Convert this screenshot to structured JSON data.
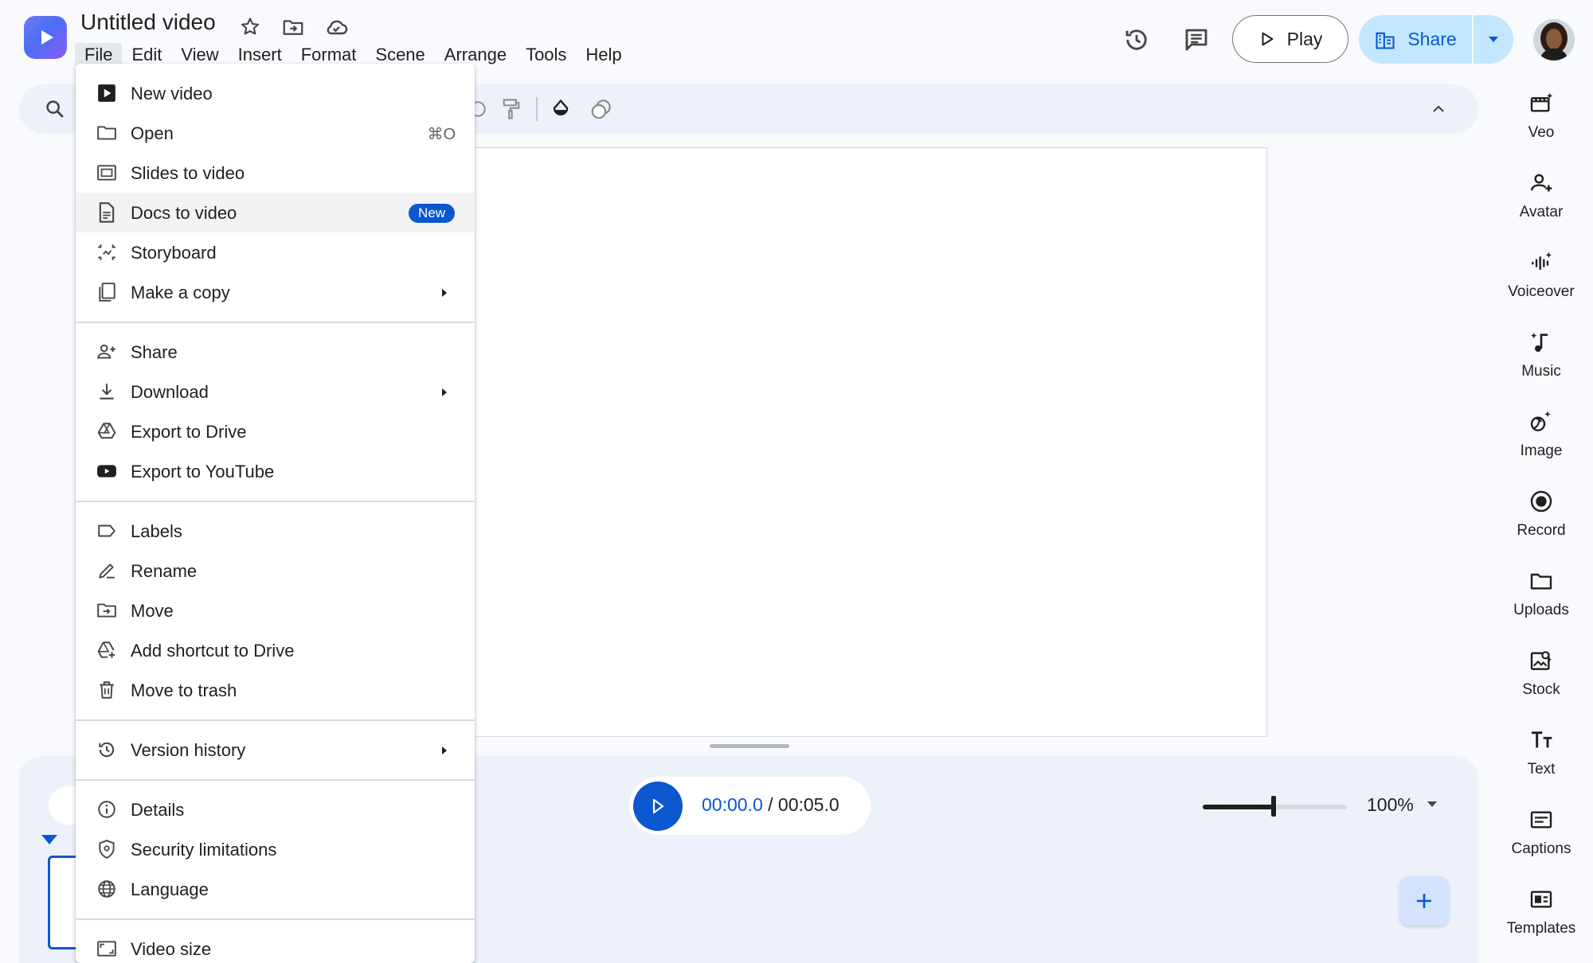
{
  "header": {
    "title": "Untitled video",
    "menus": [
      "File",
      "Edit",
      "View",
      "Insert",
      "Format",
      "Scene",
      "Arrange",
      "Tools",
      "Help"
    ],
    "play_label": "Play",
    "share_label": "Share"
  },
  "playback": {
    "current": "00:00.0",
    "separator": " / ",
    "total": "00:05.0",
    "zoom": "100%",
    "zoom_level": 0.49
  },
  "rail": [
    {
      "label": "Veo",
      "icon": "veo-icon"
    },
    {
      "label": "Avatar",
      "icon": "avatar-icon"
    },
    {
      "label": "Voiceover",
      "icon": "voiceover-icon"
    },
    {
      "label": "Music",
      "icon": "music-icon"
    },
    {
      "label": "Image",
      "icon": "image-icon"
    },
    {
      "label": "Record",
      "icon": "record-icon"
    },
    {
      "label": "Uploads",
      "icon": "uploads-icon"
    },
    {
      "label": "Stock",
      "icon": "stock-icon"
    },
    {
      "label": "Text",
      "icon": "text-icon"
    },
    {
      "label": "Captions",
      "icon": "captions-icon"
    },
    {
      "label": "Templates",
      "icon": "templates-icon"
    }
  ],
  "file_menu": {
    "new_video": "New video",
    "open": "Open",
    "open_shortcut": "⌘O",
    "slides_to_video": "Slides to video",
    "docs_to_video": "Docs to video",
    "docs_badge": "New",
    "storyboard": "Storyboard",
    "make_copy": "Make a copy",
    "share": "Share",
    "download": "Download",
    "export_drive": "Export to Drive",
    "export_youtube": "Export to YouTube",
    "labels": "Labels",
    "rename": "Rename",
    "move": "Move",
    "add_shortcut": "Add shortcut to Drive",
    "move_trash": "Move to trash",
    "version_history": "Version history",
    "details": "Details",
    "security": "Security limitations",
    "language": "Language",
    "video_size": "Video size"
  },
  "colors": {
    "accent": "#0b57d0",
    "share_bg": "#c2e7ff",
    "toolbar_bg": "#edf2fa",
    "page_bg": "#f8fafd"
  }
}
